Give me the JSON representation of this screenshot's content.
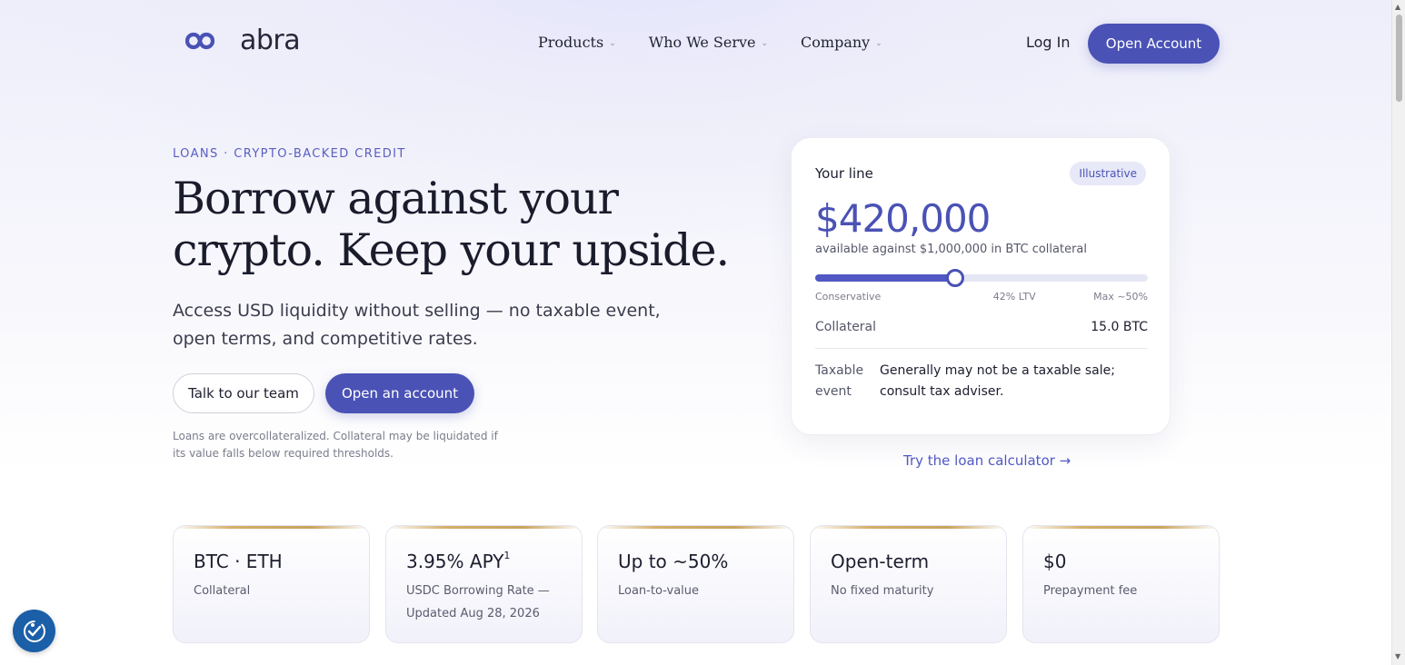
{
  "header": {
    "logo_text": "abra",
    "nav": [
      {
        "label": "Products"
      },
      {
        "label": "Who We Serve"
      },
      {
        "label": "Company"
      }
    ],
    "login_label": "Log In",
    "open_account_label": "Open Account"
  },
  "hero": {
    "eyebrow": "LOANS · CRYPTO-BACKED CREDIT",
    "title": "Borrow against your crypto. Keep your upside.",
    "subtitle": "Access USD liquidity without selling — no taxable event, open terms, and competitive rates.",
    "talk_button": "Talk to our team",
    "open_button": "Open an account",
    "disclaimer": "Loans are overcollateralized. Collateral may be liquidated if its value falls below required thresholds."
  },
  "card": {
    "title": "Your line",
    "badge": "Illustrative",
    "amount": "$420,000",
    "amount_sub": "available against $1,000,000 in BTC collateral",
    "ltv_fraction": 0.42,
    "slider_labels": {
      "left": "Conservative",
      "mid": "42% LTV",
      "right": "Max ~50%"
    },
    "collateral_label": "Collateral",
    "collateral_value": "15.0 BTC",
    "tax_label": "Taxable event",
    "tax_value": "Generally may not be a taxable sale; consult tax adviser."
  },
  "calculator_link": "Try the loan calculator →",
  "stats": [
    {
      "value": "BTC · ETH",
      "label": "Collateral"
    },
    {
      "value": "3.95% APY",
      "sup": "1",
      "label": "USDC Borrowing Rate — Updated Aug 28, 2026"
    },
    {
      "value": "Up to ~50%",
      "label": "Loan-to-value"
    },
    {
      "value": "Open-term",
      "label": "No fixed maturity"
    },
    {
      "value": "$0",
      "label": "Prepayment fee"
    }
  ],
  "colors": {
    "accent": "#4a52b5",
    "accent_text": "#5158c4",
    "gold_rule": "#d4ae6a",
    "a11y_button": "#1b5fa8"
  },
  "icons": {
    "logo": "abra-infinity-logo",
    "accessibility": "accessibility-icon",
    "chevron": "chevron-down-icon"
  }
}
